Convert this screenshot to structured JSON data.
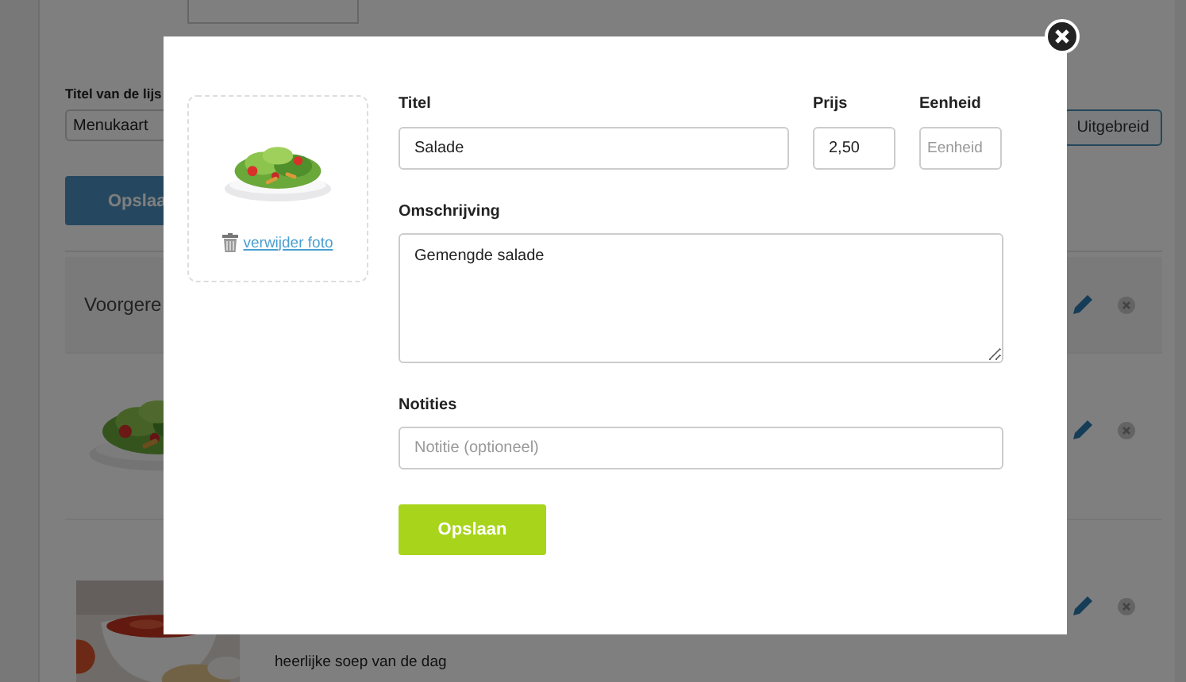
{
  "background": {
    "list_title_label": "Titel van de lijs",
    "list_title_value": "Menukaart",
    "advanced_button": "Uitgebreid",
    "save_button": "Opslaa",
    "rows": [
      {
        "kind": "header",
        "title": "Voorgere"
      },
      {
        "kind": "dish"
      },
      {
        "kind": "dish",
        "description": "heerlijke soep van de dag"
      }
    ]
  },
  "modal": {
    "photo": {
      "remove_link": "verwijder foto"
    },
    "fields": [
      {
        "label": "Titel",
        "value": "Salade"
      },
      {
        "label": "Prijs",
        "value": "2,50"
      },
      {
        "label": "Eenheid",
        "placeholder": "Eenheid"
      }
    ],
    "description": {
      "label": "Omschrijving",
      "value": "Gemengde salade"
    },
    "notes": {
      "label": "Notities",
      "placeholder": "Notitie (optioneel)"
    },
    "save_button": "Opslaan"
  }
}
